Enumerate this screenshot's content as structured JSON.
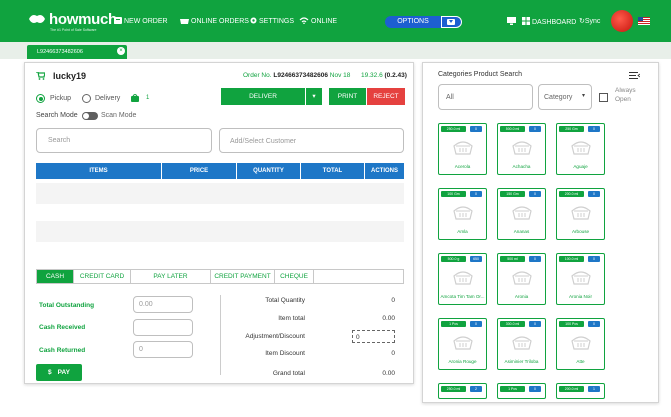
{
  "app": {
    "logo": "howmuch",
    "logo_tagline": "The #1 Point of Sale Software"
  },
  "topnav": {
    "new_order": "NEW ORDER",
    "online_orders": "ONLINE ORDERS",
    "settings": "SETTINGS",
    "online": "ONLINE",
    "options": "OPTIONS",
    "dashboard": "DASHBOARD",
    "sync": "Sync"
  },
  "tab": {
    "order_id": "L92466373482606"
  },
  "order": {
    "customer": "lucky19",
    "order_no_label": "Order No.",
    "order_no": "L92466373482606",
    "date": "Nov 18",
    "amount": "19.32.6",
    "balance": "(0.2.43)",
    "pickup": "Pickup",
    "delivery": "Delivery",
    "badge_count": "1",
    "search_mode": "Search Mode",
    "scan_mode": "Scan Mode",
    "search_placeholder": "Search",
    "customer_placeholder": "Add/Select Customer",
    "deliver": "DELIVER",
    "print": "PRINT",
    "reject": "REJECT"
  },
  "table": {
    "headers": [
      "ITEMS",
      "PRICE",
      "QUANTITY",
      "TOTAL",
      "ACTIONS"
    ]
  },
  "payment": {
    "tabs": [
      "CASH",
      "CREDIT CARD",
      "PAY LATER",
      "CREDIT PAYMENT",
      "CHEQUE"
    ],
    "total_outstanding": "Total Outstanding",
    "total_outstanding_value": "0.00",
    "cash_received": "Cash Received",
    "cash_received_value": "",
    "cash_returned": "Cash Returned",
    "cash_returned_value": "0",
    "pay": "PAY",
    "pay_symbol": "$"
  },
  "summary": {
    "total_quantity": "Total Quantity",
    "total_quantity_value": "0",
    "item_total": "Item total",
    "item_total_value": "0.00",
    "adjustment": "Adjustment/Discount",
    "adjustment_value": "0",
    "item_discount": "Item Discount",
    "item_discount_value": "0",
    "grand_total": "Grand total",
    "grand_total_value": "0.00"
  },
  "catalog": {
    "title": "Categories Product Search",
    "search_value": "All",
    "category_placeholder": "Category",
    "always_open": "Always Open",
    "products": [
      {
        "name": "Acerola",
        "qty": "250.0 ml",
        "num": "0"
      },
      {
        "name": "Achacha",
        "qty": "500.0 ml",
        "num": "0"
      },
      {
        "name": "Aguaje",
        "qty": "250 Gm",
        "num": "0"
      },
      {
        "name": "Amla",
        "qty": "100 Gm",
        "num": "0"
      },
      {
        "name": "Ananas",
        "qty": "150 Gm",
        "num": "0"
      },
      {
        "name": "Arbouse",
        "qty": "200.0 ml",
        "num": "0"
      },
      {
        "name": "Amcota Tim Tam Or...",
        "qty": "500.0 g",
        "num": "650"
      },
      {
        "name": "Aronia",
        "qty": "500 ml",
        "num": "0"
      },
      {
        "name": "Aronia Noir",
        "qty": "100.0 ml",
        "num": "0"
      },
      {
        "name": "Aronia Rouge",
        "qty": "1 Pcs",
        "num": "0"
      },
      {
        "name": "Asiminier Triloba",
        "qty": "300.0 ml",
        "num": "0"
      },
      {
        "name": "Atte",
        "qty": "100 Pcs",
        "num": "0"
      },
      {
        "name": "",
        "qty": "250.0 ml",
        "num": "2"
      },
      {
        "name": "",
        "qty": "1 Pcs",
        "num": "0"
      },
      {
        "name": "",
        "qty": "200.0 ml",
        "num": "1"
      }
    ]
  },
  "colors": {
    "brand_green": "#10a33f",
    "blue": "#1e77c7",
    "reject_red": "#e5413f",
    "options_blue": "#1d5fd1"
  }
}
